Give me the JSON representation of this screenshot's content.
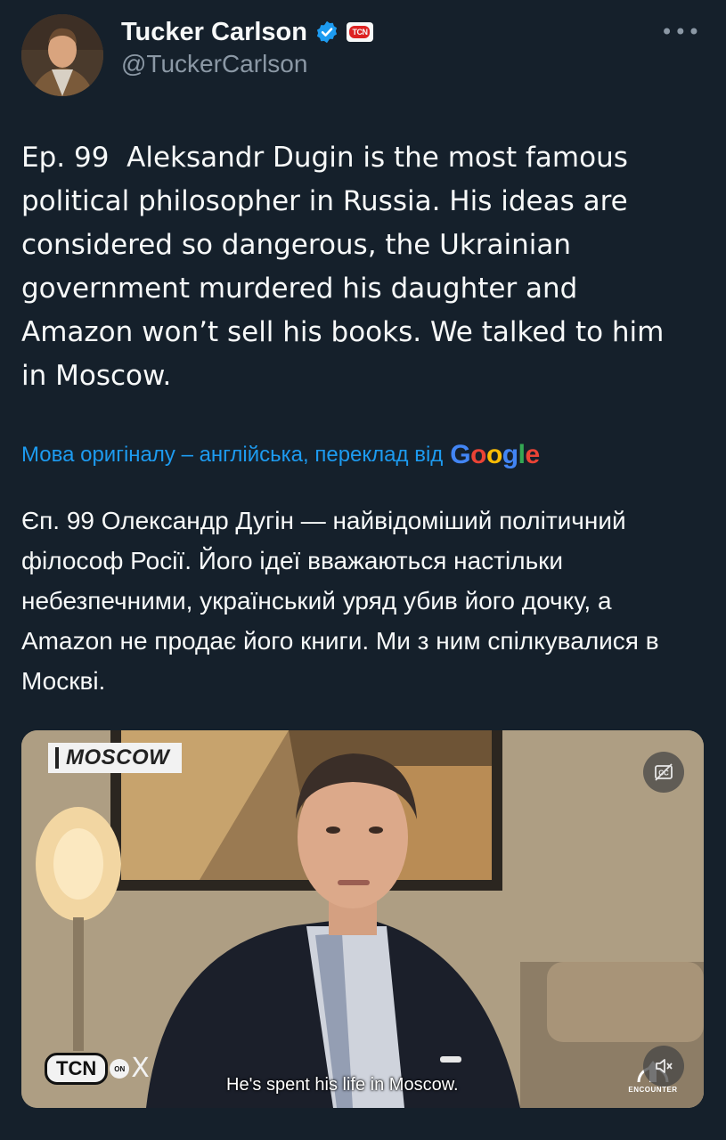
{
  "author": {
    "name": "Tucker Carlson",
    "handle": "@TuckerCarlson",
    "org_badge": "TCN",
    "verified_color": "#1d9bf0"
  },
  "more_label": "•••",
  "tweet": {
    "text": "Ep. 99  Aleksandr Dugin is the most famous\npolitical philosopher in Russia. His ideas are\nconsidered so dangerous, the Ukrainian\ngovernment murdered his daughter and\nAmazon won’t sell his books. We talked to him\nin Moscow."
  },
  "translation": {
    "label": "Мова оригіналу – англійська, переклад від",
    "provider": "Google",
    "text": "Єп. 99 Олександр Дугін — найвідоміший політичний філософ Росії. Його ідеї вважаються настільки небезпечними, український уряд убив його дочку, а Amazon не продає його книги. Ми з ним спілкувалися в Москві."
  },
  "video": {
    "location": "MOSCOW",
    "subtitle": "He's spent his life in Moscow.",
    "logo_left": "TCN",
    "logo_on": "ON",
    "logo_x": "X",
    "logo_right": "ENCOUNTER",
    "cc_icon": "captions-icon",
    "mute_icon": "speaker-muted-icon"
  },
  "colors": {
    "background": "#15202b",
    "link": "#1d9bf0",
    "muted": "#8b98a5"
  }
}
